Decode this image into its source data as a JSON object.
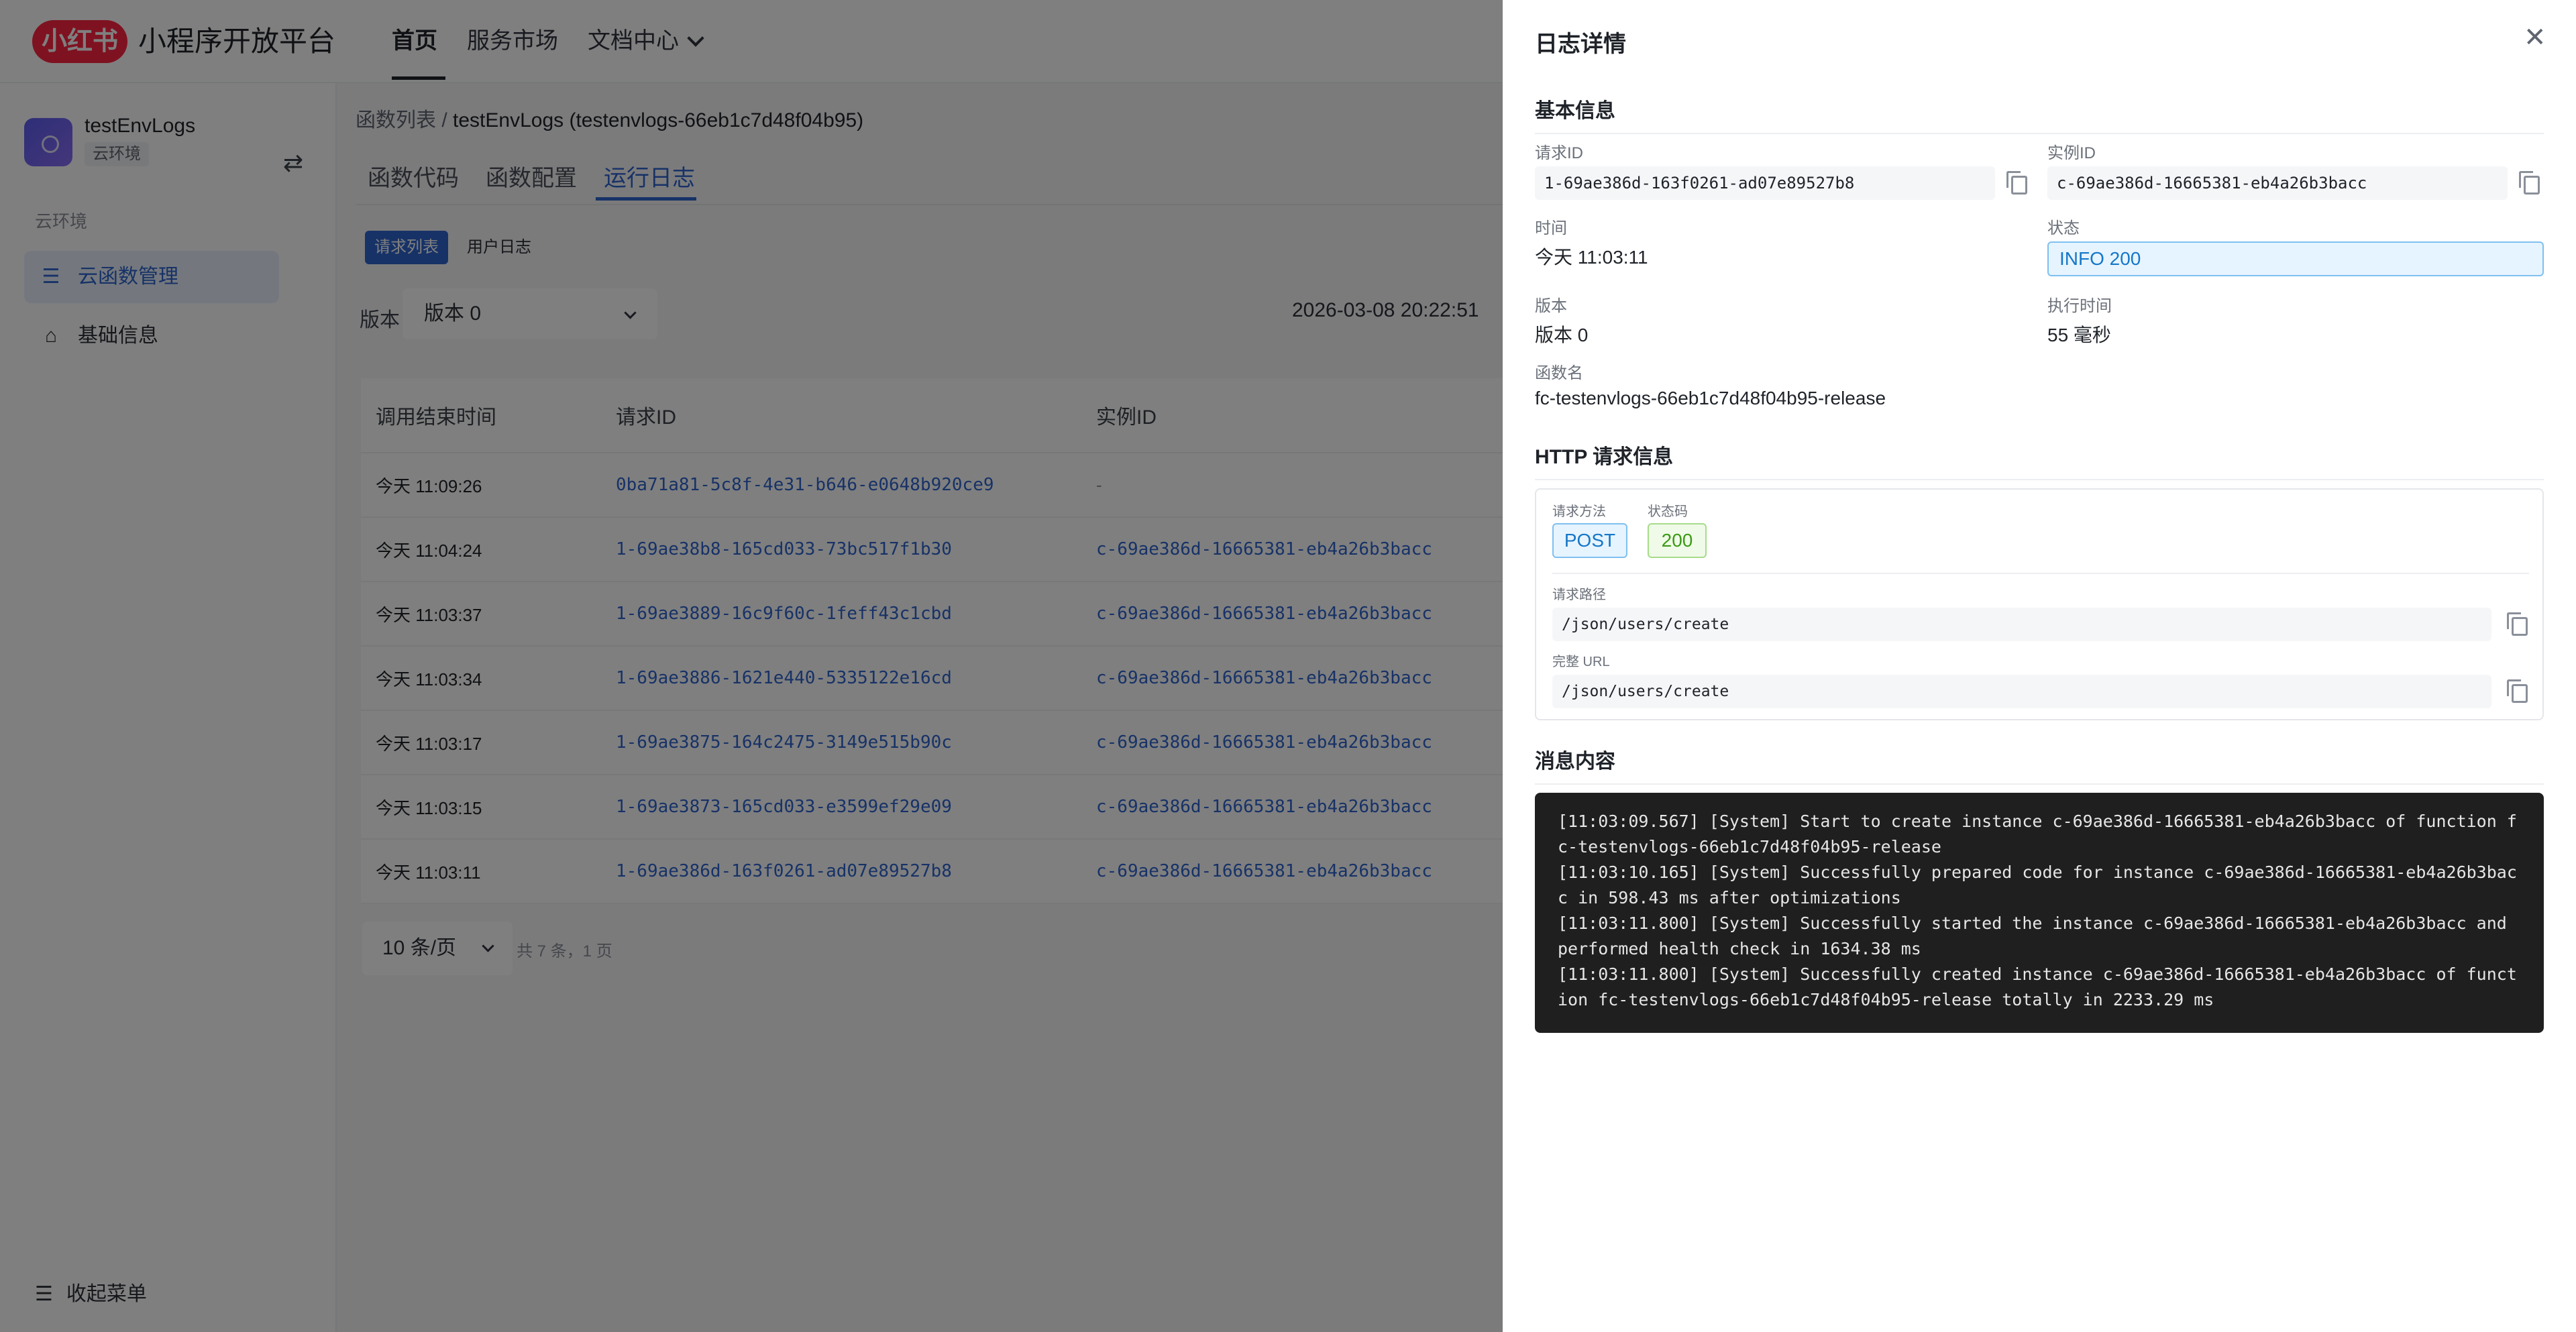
{
  "header": {
    "logo_text": "小红书",
    "platform_title": "小程序开放平台",
    "nav": [
      {
        "label": "首页"
      },
      {
        "label": "服务市场"
      },
      {
        "label": "文档中心"
      }
    ]
  },
  "sidebar": {
    "env_name": "testEnvLogs",
    "env_tag": "云环境",
    "group_label": "云环境",
    "items": [
      {
        "label": "云函数管理",
        "icon": "list-icon"
      },
      {
        "label": "基础信息",
        "icon": "home-icon"
      }
    ],
    "collapse_label": "收起菜单"
  },
  "main": {
    "breadcrumb": {
      "parent": "函数列表",
      "separator": "/",
      "current": "testEnvLogs (testenvlogs-66eb1c7d48f04b95)"
    },
    "tabs": [
      {
        "label": "函数代码"
      },
      {
        "label": "函数配置"
      },
      {
        "label": "运行日志"
      }
    ],
    "segmented": [
      "请求列表",
      "用户日志"
    ],
    "version_label": "版本",
    "version_value": "版本 0",
    "timestamp": "2026-03-08 20:22:51",
    "table": {
      "headers": [
        "调用结束时间",
        "请求ID",
        "实例ID"
      ],
      "rows": [
        {
          "time": "今天 11:09:26",
          "request_id": "0ba71a81-5c8f-4e31-b646-e0648b920ce9",
          "instance_id": "-"
        },
        {
          "time": "今天 11:04:24",
          "request_id": "1-69ae38b8-165cd033-73bc517f1b30",
          "instance_id": "c-69ae386d-16665381-eb4a26b3bacc"
        },
        {
          "time": "今天 11:03:37",
          "request_id": "1-69ae3889-16c9f60c-1feff43c1cbd",
          "instance_id": "c-69ae386d-16665381-eb4a26b3bacc"
        },
        {
          "time": "今天 11:03:34",
          "request_id": "1-69ae3886-1621e440-5335122e16cd",
          "instance_id": "c-69ae386d-16665381-eb4a26b3bacc"
        },
        {
          "time": "今天 11:03:17",
          "request_id": "1-69ae3875-164c2475-3149e515b90c",
          "instance_id": "c-69ae386d-16665381-eb4a26b3bacc"
        },
        {
          "time": "今天 11:03:15",
          "request_id": "1-69ae3873-165cd033-e3599ef29e09",
          "instance_id": "c-69ae386d-16665381-eb4a26b3bacc"
        },
        {
          "time": "今天 11:03:11",
          "request_id": "1-69ae386d-163f0261-ad07e89527b8",
          "instance_id": "c-69ae386d-16665381-eb4a26b3bacc"
        }
      ]
    },
    "pager": {
      "page_size": "10 条/页",
      "total": "共 7 条，1 页"
    }
  },
  "drawer": {
    "title": "日志详情",
    "basic_section": "基本信息",
    "request_id_label": "请求ID",
    "request_id": "1-69ae386d-163f0261-ad07e89527b8",
    "instance_id_label": "实例ID",
    "instance_id": "c-69ae386d-16665381-eb4a26b3bacc",
    "time_label": "时间",
    "time_value": "今天 11:03:11",
    "status_label": "状态",
    "status_value": "INFO 200",
    "version_label": "版本",
    "version_value": "版本 0",
    "exec_label": "执行时间",
    "exec_value": "55 毫秒",
    "fn_label": "函数名",
    "fn_value": "fc-testenvlogs-66eb1c7d48f04b95-release",
    "http_section": "HTTP 请求信息",
    "method_label": "请求方法",
    "method_value": "POST",
    "code_label": "状态码",
    "code_value": "200",
    "path_label": "请求路径",
    "path_value": "/json/users/create",
    "url_label": "完整 URL",
    "url_value": "/json/users/create",
    "message_section": "消息内容",
    "messages": [
      "[11:03:09.567] [System] Start to create instance c-69ae386d-16665381-eb4a26b3bacc of function fc-testenvlogs-66eb1c7d48f04b95-release",
      "[11:03:10.165] [System] Successfully prepared code for instance c-69ae386d-16665381-eb4a26b3bacc in 598.43 ms after optimizations",
      "[11:03:11.800] [System] Successfully started the instance c-69ae386d-16665381-eb4a26b3bacc and performed health check in 1634.38 ms",
      "[11:03:11.800] [System] Successfully created instance c-69ae386d-16665381-eb4a26b3bacc of function fc-testenvlogs-66eb1c7d48f04b95-release totally in 2233.29 ms"
    ]
  },
  "colors": {
    "accent": "#2f64ce",
    "brand": "#ff2442",
    "overlay": "rgba(0,0,0,0.5)"
  }
}
